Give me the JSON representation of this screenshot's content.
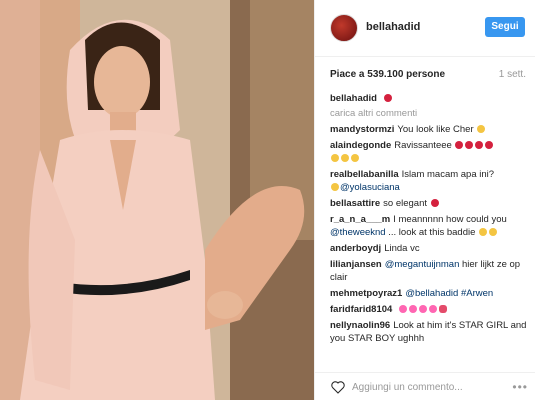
{
  "post": {
    "username": "bellahadid",
    "follow_label": "Segui",
    "likes": "Piace a 539.100 persone",
    "time": "1 sett.",
    "caption_user": "bellahadid",
    "load_more": "carica altri commenti"
  },
  "comments": [
    {
      "user": "mandystormzi",
      "text": "You look like Cher"
    },
    {
      "user": "alaindegonde",
      "text": "Ravissanteee"
    },
    {
      "user": "realbellabanilla",
      "text": "Islam macam apa ini?",
      "mention": "@yolasuciana"
    },
    {
      "user": "bellasattire",
      "text": "so elegant"
    },
    {
      "user": "r_a_n_a___m",
      "text": "I meannnnn how could you",
      "mention": "@theweeknd",
      "text2": "... look at this baddie"
    },
    {
      "user": "anderboydj",
      "text": "Linda vc"
    },
    {
      "user": "lilianjansen",
      "mention": "@megantuijnman",
      "text": "hier lijkt ze op clair"
    },
    {
      "user": "mehmetpoyraz1",
      "mention": "@bellahadid #Arwen",
      "text": ""
    },
    {
      "user": "faridfarid8104",
      "text": ""
    },
    {
      "user": "nellynaolin96",
      "text": "Look at him it's STAR GIRL and you STAR BOY ughhh"
    }
  ],
  "footer": {
    "placeholder": "Aggiungi un commento...",
    "more_label": "•••"
  },
  "icons": {
    "avatar": "profile-avatar",
    "heart": "heart-icon",
    "more": "more-options-icon"
  }
}
